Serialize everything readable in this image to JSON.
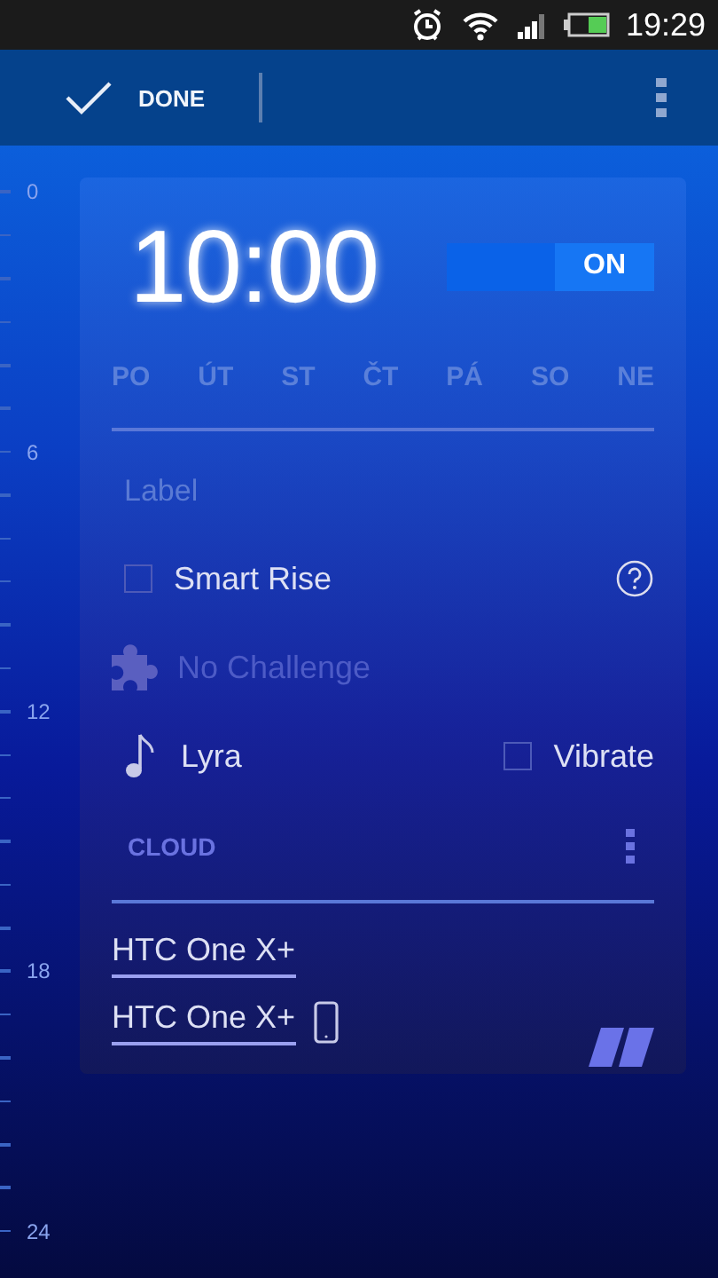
{
  "status_bar": {
    "time": "19:29"
  },
  "action_bar": {
    "done": "DONE"
  },
  "ruler": {
    "labels": [
      "0",
      "6",
      "12",
      "18",
      "24"
    ]
  },
  "alarm": {
    "time": "10:00",
    "toggle": {
      "label": "ON",
      "on": true
    },
    "days": [
      {
        "label": "PO",
        "selected": false
      },
      {
        "label": "ÚT",
        "selected": false
      },
      {
        "label": "ST",
        "selected": false
      },
      {
        "label": "ČT",
        "selected": false
      },
      {
        "label": "PÁ",
        "selected": false
      },
      {
        "label": "SO",
        "selected": false
      },
      {
        "label": "NE",
        "selected": false
      }
    ],
    "label_field": {
      "placeholder": "Label"
    },
    "smart_rise": {
      "label": "Smart Rise",
      "checked": false
    },
    "challenge": {
      "label": "No Challenge",
      "disabled": true
    },
    "sound": {
      "label": "Lyra"
    },
    "vibrate": {
      "label": "Vibrate",
      "checked": false
    },
    "cloud": {
      "title": "CLOUD",
      "devices": [
        {
          "name": "HTC One X+",
          "current": false
        },
        {
          "name": "HTC One X+",
          "current": true
        }
      ]
    }
  }
}
